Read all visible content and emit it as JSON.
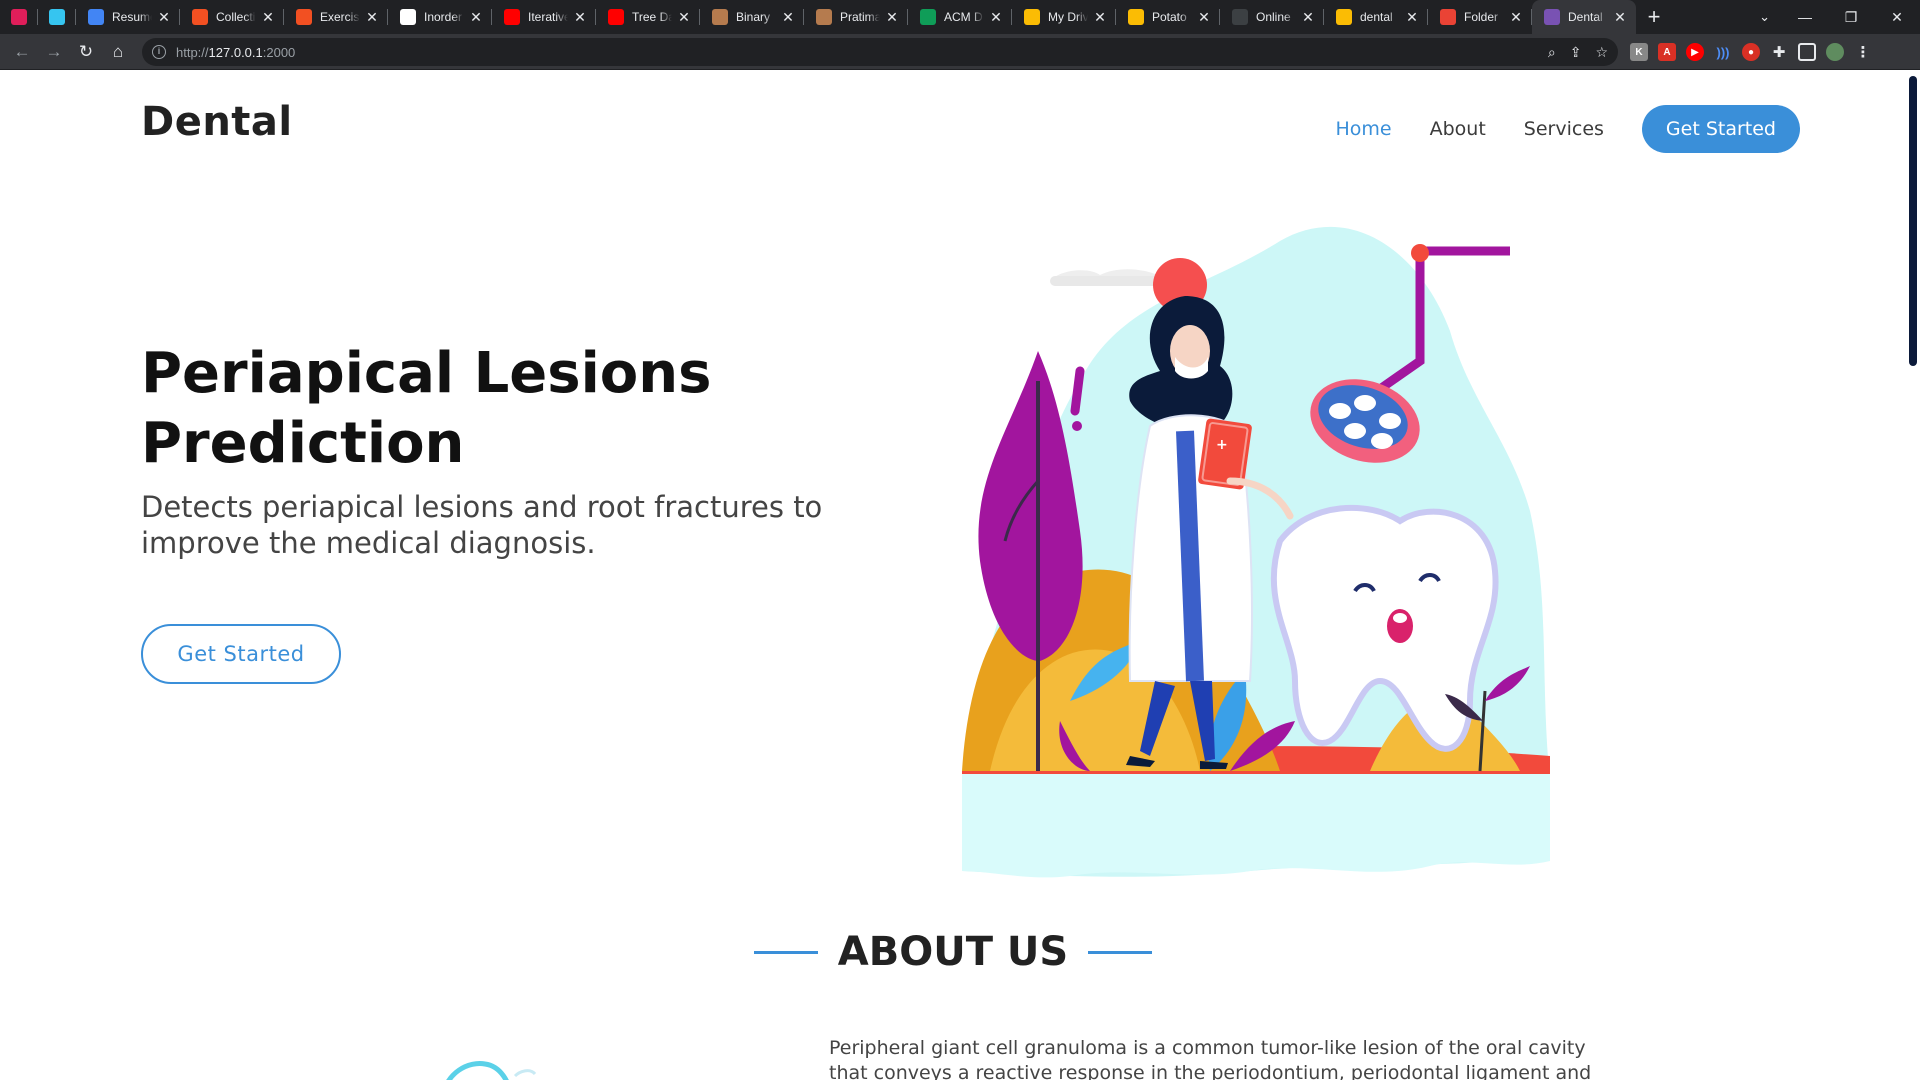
{
  "browser": {
    "tabs": [
      {
        "label": "",
        "icon": "slack-icon",
        "color": "#e01e5a",
        "pinned": true
      },
      {
        "label": "",
        "icon": "slack-icon",
        "color": "#36c5f0",
        "pinned": true
      },
      {
        "label": "Resume",
        "icon": "docs-icon",
        "color": "#4285f4"
      },
      {
        "label": "Collecti",
        "icon": "microsoft-icon",
        "color": "#f25022"
      },
      {
        "label": "Exercise",
        "icon": "microsoft-icon",
        "color": "#f25022"
      },
      {
        "label": "Inorder",
        "icon": "google-icon",
        "color": "#ffffff"
      },
      {
        "label": "Iterative",
        "icon": "youtube-icon",
        "color": "#ff0000"
      },
      {
        "label": "Tree Da",
        "icon": "youtube-icon",
        "color": "#ff0000"
      },
      {
        "label": "Binary",
        "icon": "codechef-icon",
        "color": "#b57b4e"
      },
      {
        "label": "Pratima",
        "icon": "codechef-icon",
        "color": "#b57b4e"
      },
      {
        "label": "ACM D",
        "icon": "sheets-icon",
        "color": "#0f9d58"
      },
      {
        "label": "My Driv",
        "icon": "drive-icon",
        "color": "#fbbc04"
      },
      {
        "label": "Potato",
        "icon": "drive-icon",
        "color": "#fbbc04"
      },
      {
        "label": "Online",
        "icon": "d-icon",
        "color": "#3c4043"
      },
      {
        "label": "dental",
        "icon": "drive-icon",
        "color": "#fbbc04"
      },
      {
        "label": "Folder",
        "icon": "gmail-icon",
        "color": "#ea4335"
      },
      {
        "label": "Dental",
        "icon": "bootstrap-icon",
        "color": "#7952b3",
        "active": true
      }
    ],
    "url_host": "127.0.0.1",
    "url_prefix": "http://",
    "url_port": ":2000"
  },
  "nav": {
    "brand": "Dental",
    "links": [
      {
        "label": "Home",
        "active": true
      },
      {
        "label": "About"
      },
      {
        "label": "Services"
      }
    ],
    "cta": "Get Started"
  },
  "hero": {
    "title": "Periapical Lesions Prediction",
    "subtitle": "Detects periapical lesions and root fractures to improve the medical diagnosis.",
    "button": "Get Started"
  },
  "about": {
    "heading": "ABOUT US",
    "text": "Peripheral giant cell granuloma is a common tumor-like lesion of the oral cavity that conveys a reactive response in the periodontium, periodontal ligament and gingivae. Our"
  },
  "colors": {
    "accent": "#3a8fd9",
    "chrome_dark": "#202124",
    "chrome_toolbar": "#35363a"
  }
}
